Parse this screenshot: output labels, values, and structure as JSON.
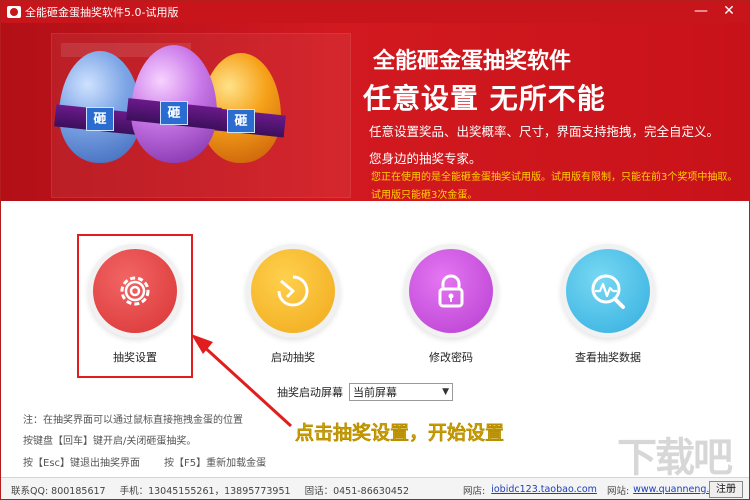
{
  "window": {
    "title": "全能砸金蛋抽奖软件5.0-试用版",
    "minimize_glyph": "—",
    "close_glyph": "✕"
  },
  "banner": {
    "egg_char": "砸",
    "headline1": "全能砸金蛋抽奖软件",
    "headline2": "任意设置  无所不能",
    "tagline1": "任意设置奖品、出奖概率、尺寸，界面支持拖拽，完全自定义。",
    "tagline2": "您身边的抽奖专家。",
    "notice1": "您正在使用的是全能砸金蛋抽奖试用版。试用版有限制，只能在前3个奖项中抽取。",
    "notice2": "试用版只能砸3次金蛋。"
  },
  "functions": [
    {
      "label": "抽奖设置",
      "icon": "gear-icon",
      "color": "#e04444"
    },
    {
      "label": "启动抽奖",
      "icon": "start-icon",
      "color": "#f4b42a"
    },
    {
      "label": "修改密码",
      "icon": "lock-icon",
      "color": "#c54ad9"
    },
    {
      "label": "查看抽奖数据",
      "icon": "chart-search-icon",
      "color": "#3fb7e6"
    }
  ],
  "screen": {
    "label": "抽奖启动屏幕",
    "selected": "当前屏幕"
  },
  "hints": {
    "line1": "注：在抽奖界面可以通过鼠标直接拖拽金蛋的位置",
    "line2": "按键盘【回车】键开启/关闭砸蛋抽奖。",
    "line3": "按【Esc】键退出抽奖界面",
    "line4": "按【F5】重新加载金蛋"
  },
  "annotation": {
    "text": "点击抽奖设置，开始设置"
  },
  "footer": {
    "contact": "联系QQ: 800185617",
    "phone": "手机：13045155261，13895773951",
    "landline": "固话：0451-86630452",
    "site_label": "网店:",
    "site_link": "iobidc123.taobao.com",
    "web_label": "网站:",
    "web_link": "www.quanneng...ft.cn",
    "register": "注册"
  },
  "watermark": "下载吧"
}
